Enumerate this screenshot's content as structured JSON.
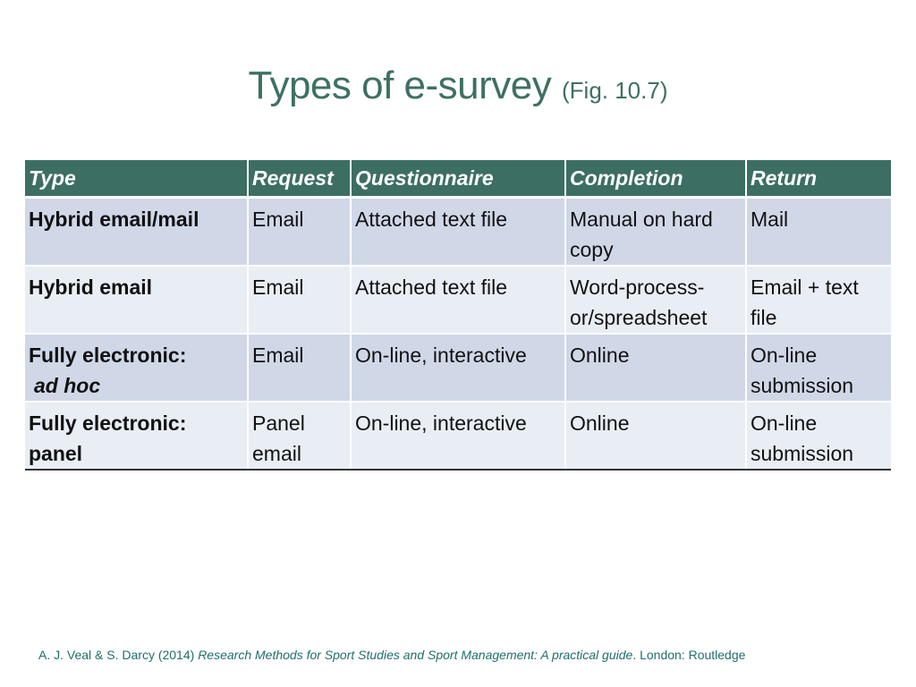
{
  "slide": {
    "title": "Types of e-survey",
    "title_suffix": "(Fig. 10.7)"
  },
  "table": {
    "headers": [
      "Type",
      "Request",
      "Questionnaire",
      "Completion",
      "Return"
    ],
    "rows": [
      {
        "type": "Hybrid email/mail",
        "type_sub": "",
        "request": "Email",
        "questionnaire": "Attached text file",
        "completion": "Manual on hard copy",
        "return": "Mail"
      },
      {
        "type": "Hybrid email",
        "type_sub": "",
        "request": "Email",
        "questionnaire": "Attached text file",
        "completion": "Word-process-or/spreadsheet",
        "return": "Email + text file"
      },
      {
        "type": "Fully electronic:",
        "type_sub": "ad hoc",
        "request": "Email",
        "questionnaire": "On-line, interactive",
        "completion": "Online",
        "return": "On-line submission"
      },
      {
        "type": "Fully electronic:",
        "type_sub": "panel",
        "request": "Panel email",
        "questionnaire": "On-line, interactive",
        "completion": "Online",
        "return": "On-line submission"
      }
    ]
  },
  "footer": {
    "authors": "A. J. Veal & S. Darcy (2014)",
    "book_title": "Research Methods for Sport Studies and Sport Management: A practical guide",
    "publisher": ". London: Routledge"
  }
}
